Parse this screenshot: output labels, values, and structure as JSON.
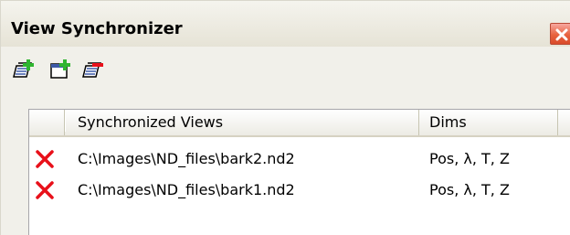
{
  "window": {
    "title": "View Synchronizer"
  },
  "toolbar": {
    "buttons": [
      {
        "icon": "add-view-icon"
      },
      {
        "icon": "add-window-icon"
      },
      {
        "icon": "remove-view-icon"
      }
    ]
  },
  "list": {
    "columns": {
      "views": "Synchronized Views",
      "dims": "Dims"
    },
    "rows": [
      {
        "path": "C:\\Images\\ND_files\\bark2.nd2",
        "dims": "Pos, λ, T, Z",
        "icon": "remove-icon"
      },
      {
        "path": "C:\\Images\\ND_files\\bark1.nd2",
        "dims": "Pos, λ, T, Z",
        "icon": "remove-icon"
      }
    ]
  },
  "colors": {
    "remove": "#e8101a",
    "close_button": "#e8633f",
    "add_green": "#2fb52f"
  }
}
